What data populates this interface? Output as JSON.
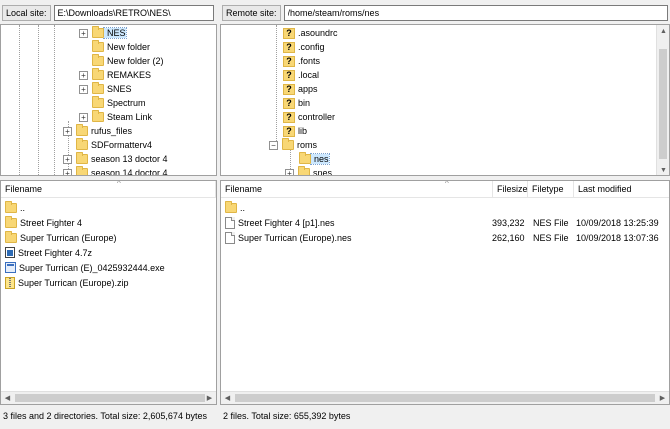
{
  "local": {
    "site_label": "Local site:",
    "site_path": "E:\\Downloads\\RETRO\\NES\\",
    "tree": [
      {
        "label": "NES",
        "expander": "+",
        "selected": true
      },
      {
        "label": "New folder",
        "expander": ""
      },
      {
        "label": "New folder (2)",
        "expander": ""
      },
      {
        "label": "REMAKES",
        "expander": "+"
      },
      {
        "label": "SNES",
        "expander": "+"
      },
      {
        "label": "Spectrum",
        "expander": ""
      },
      {
        "label": "Steam Link",
        "expander": "+"
      },
      {
        "label": "rufus_files",
        "expander": "+"
      },
      {
        "label": "SDFormatterv4",
        "expander": ""
      },
      {
        "label": "season 13 doctor 4",
        "expander": "+"
      },
      {
        "label": "season 14 doctor 4",
        "expander": "+"
      }
    ],
    "column_filename": "Filename",
    "files": [
      {
        "name": "..",
        "icon": "folder-icon"
      },
      {
        "name": "Street Fighter 4",
        "icon": "folder-icon"
      },
      {
        "name": "Super Turrican (Europe)",
        "icon": "folder-icon"
      },
      {
        "name": "Street Fighter 4.7z",
        "icon": "archive-7z-icon"
      },
      {
        "name": "Super Turrican (E)_0425932444.exe",
        "icon": "exe-icon"
      },
      {
        "name": "Super Turrican (Europe).zip",
        "icon": "zip-icon"
      }
    ],
    "status": "3 files and 2 directories. Total size: 2,605,674 bytes"
  },
  "remote": {
    "site_label": "Remote site:",
    "site_path": "/home/steam/roms/nes",
    "tree": [
      {
        "label": ".asoundrc",
        "type": "unknown"
      },
      {
        "label": ".config",
        "type": "unknown"
      },
      {
        "label": ".fonts",
        "type": "unknown"
      },
      {
        "label": ".local",
        "type": "unknown"
      },
      {
        "label": "apps",
        "type": "unknown"
      },
      {
        "label": "bin",
        "type": "unknown"
      },
      {
        "label": "controller",
        "type": "unknown"
      },
      {
        "label": "lib",
        "type": "unknown"
      },
      {
        "label": "roms",
        "type": "folder",
        "expander": "−"
      },
      {
        "label": "nes",
        "type": "folder",
        "selected": true
      },
      {
        "label": "snes",
        "type": "folder",
        "expander": "+"
      }
    ],
    "columns": {
      "filename": "Filename",
      "filesize": "Filesize",
      "filetype": "Filetype",
      "modified": "Last modified"
    },
    "files": [
      {
        "name": "..",
        "size": "",
        "type": "",
        "modified": "",
        "icon": "folder-icon"
      },
      {
        "name": "Street Fighter 4 [p1].nes",
        "size": "393,232",
        "type": "NES File",
        "modified": "10/09/2018 13:25:39",
        "icon": "file-icon"
      },
      {
        "name": "Super Turrican (Europe).nes",
        "size": "262,160",
        "type": "NES File",
        "modified": "10/09/2018 13:07:36",
        "icon": "file-icon"
      }
    ],
    "status": "2 files. Total size: 655,392 bytes"
  }
}
